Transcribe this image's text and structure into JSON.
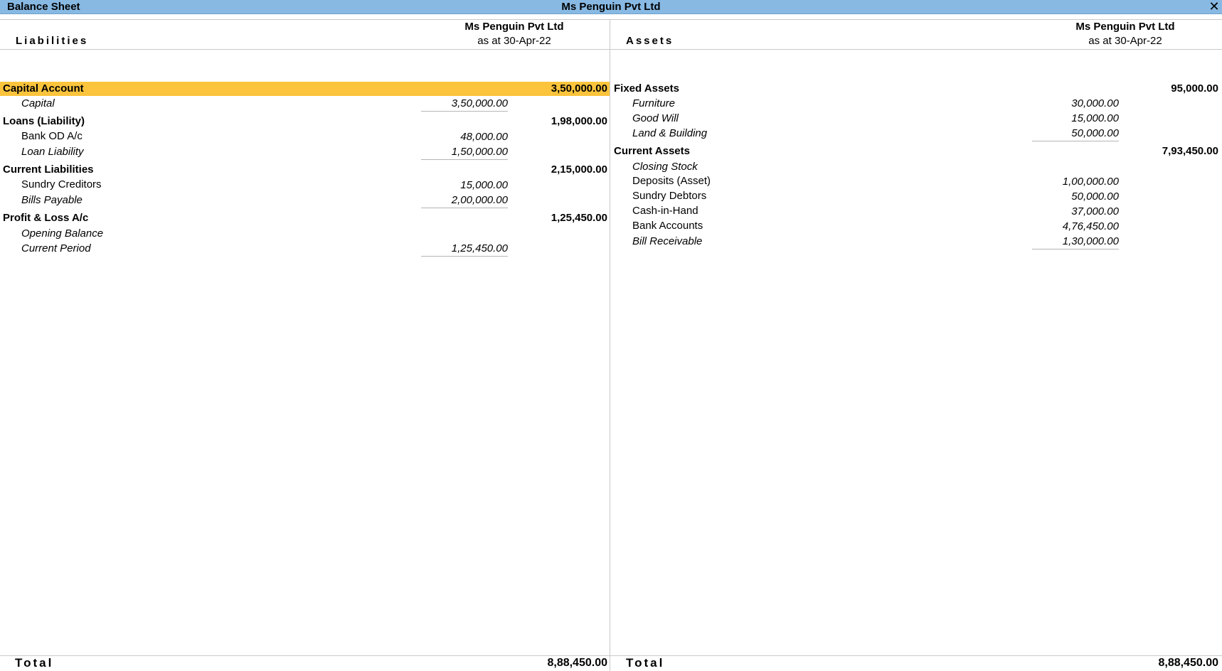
{
  "window": {
    "title": "Balance Sheet",
    "company": "Ms Penguin Pvt Ltd",
    "close_icon": "close-icon"
  },
  "colors": {
    "titlebar": "#87b9e3",
    "highlight": "#fcc43c"
  },
  "liabilities": {
    "label": "Liabilities",
    "col_company": "Ms Penguin Pvt Ltd",
    "col_date": "as at 30-Apr-22",
    "groups": [
      {
        "name": "Capital Account",
        "total": "3,50,000.00",
        "items": [
          {
            "name": "Capital",
            "amount": "3,50,000.00"
          }
        ]
      },
      {
        "name": "Loans (Liability)",
        "total": "1,98,000.00",
        "items": [
          {
            "name": "Bank OD A/c",
            "amount": "48,000.00"
          },
          {
            "name": "Loan Liability",
            "amount": "1,50,000.00"
          }
        ]
      },
      {
        "name": "Current Liabilities",
        "total": "2,15,000.00",
        "items": [
          {
            "name": "Sundry Creditors",
            "amount": "15,000.00"
          },
          {
            "name": "Bills Payable",
            "amount": "2,00,000.00"
          }
        ]
      },
      {
        "name": "Profit & Loss A/c",
        "total": "1,25,450.00",
        "items": [
          {
            "name": "Opening Balance",
            "amount": ""
          },
          {
            "name": "Current Period",
            "amount": "1,25,450.00"
          }
        ]
      }
    ],
    "total_label": "Total",
    "total": "8,88,450.00"
  },
  "assets": {
    "label": "Assets",
    "col_company": "Ms Penguin Pvt Ltd",
    "col_date": "as at 30-Apr-22",
    "groups": [
      {
        "name": "Fixed Assets",
        "total": "95,000.00",
        "items": [
          {
            "name": "Furniture",
            "amount": "30,000.00"
          },
          {
            "name": "Good Will",
            "amount": "15,000.00"
          },
          {
            "name": "Land & Building",
            "amount": "50,000.00"
          }
        ]
      },
      {
        "name": "Current Assets",
        "total": "7,93,450.00",
        "items": [
          {
            "name": "Closing Stock",
            "amount": ""
          },
          {
            "name": "Deposits (Asset)",
            "amount": "1,00,000.00"
          },
          {
            "name": "Sundry Debtors",
            "amount": "50,000.00"
          },
          {
            "name": "Cash-in-Hand",
            "amount": "37,000.00"
          },
          {
            "name": "Bank Accounts",
            "amount": "4,76,450.00"
          },
          {
            "name": "Bill Receivable",
            "amount": "1,30,000.00"
          }
        ]
      }
    ],
    "total_label": "Total",
    "total": "8,88,450.00"
  }
}
